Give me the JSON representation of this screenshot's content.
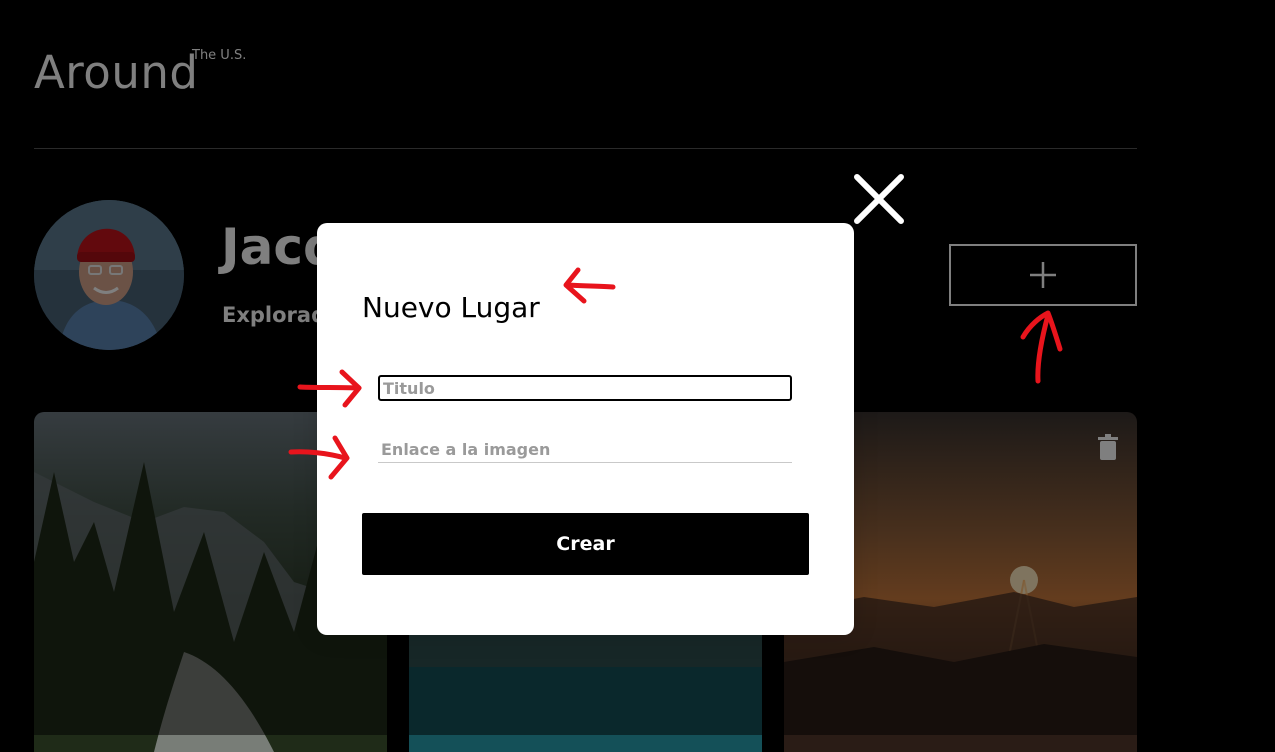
{
  "header": {
    "logo": "Around",
    "logo_sup": "The U.S."
  },
  "profile": {
    "name": "Jacques Cousteau",
    "about": "Explorador"
  },
  "popup": {
    "title": "Nuevo Lugar",
    "title_placeholder": "Titulo",
    "link_placeholder": "Enlace a la imagen",
    "submit_label": "Crear"
  },
  "colors": {
    "background": "#000000",
    "modal_bg": "#ffffff",
    "annotation": "#e8141c"
  },
  "icons": {
    "close": "close-icon",
    "add": "plus-icon",
    "delete": "trash-icon"
  }
}
